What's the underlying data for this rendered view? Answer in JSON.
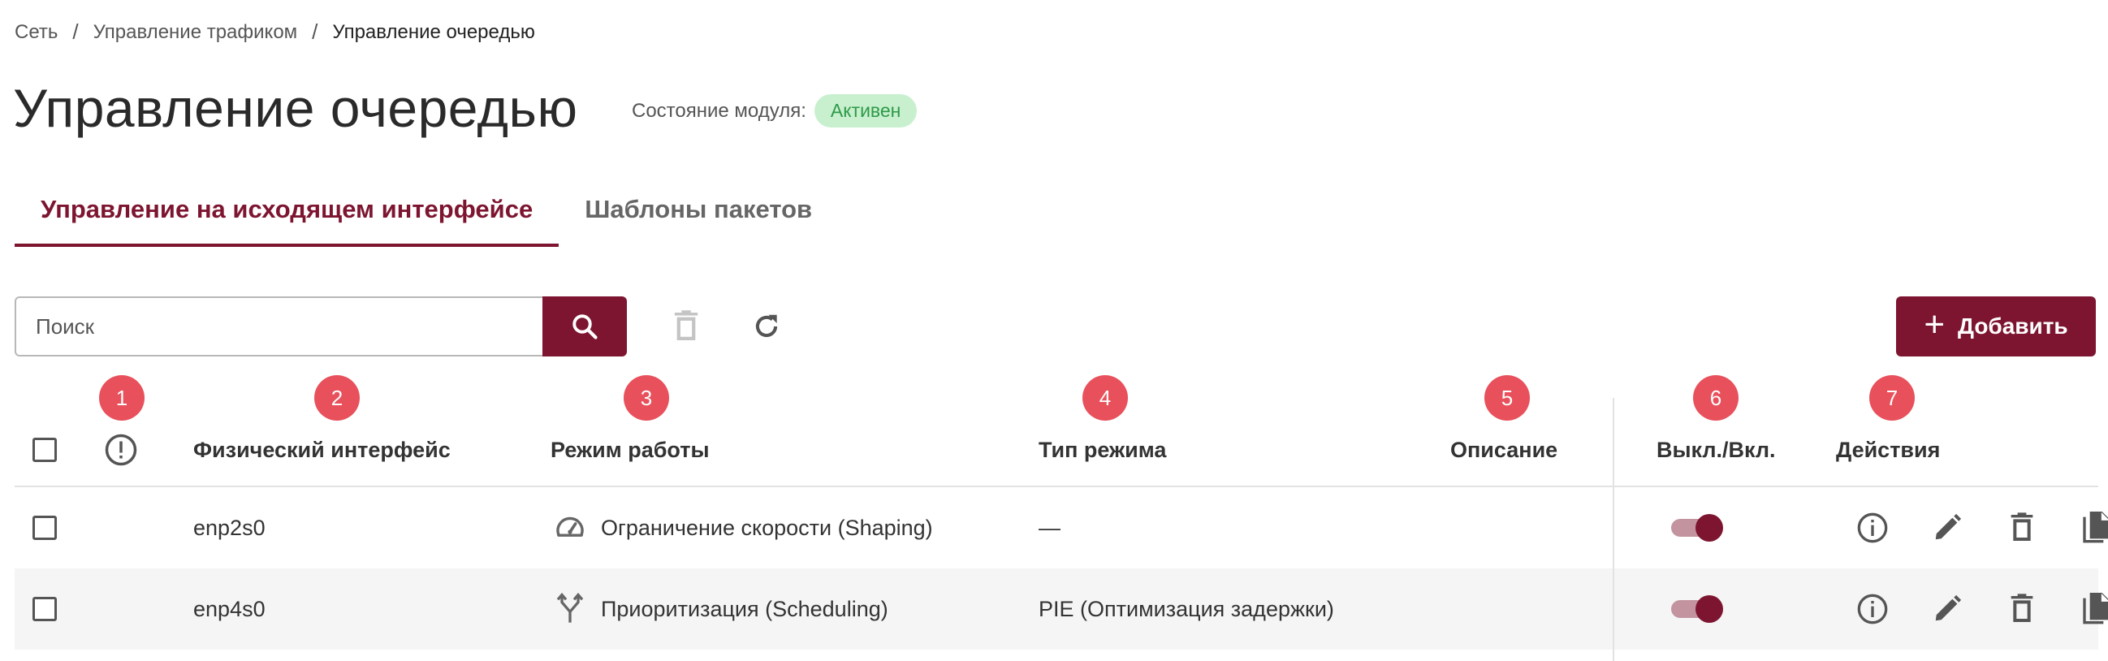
{
  "breadcrumb": {
    "items": [
      "Сеть",
      "Управление трафиком",
      "Управление очередью"
    ],
    "separator": "/"
  },
  "header": {
    "title": "Управление очередью",
    "module_state_label": "Состояние модуля:",
    "module_state_value": "Активен"
  },
  "tabs": [
    {
      "label": "Управление на исходящем интерфейсе",
      "active": true
    },
    {
      "label": "Шаблоны пакетов",
      "active": false
    }
  ],
  "toolbar": {
    "search_placeholder": "Поиск",
    "add_label": "Добавить"
  },
  "markers": [
    "1",
    "2",
    "3",
    "4",
    "5",
    "6",
    "7"
  ],
  "table": {
    "columns": {
      "interface": "Физический интерфейс",
      "mode": "Режим работы",
      "mode_type": "Тип режима",
      "description": "Описание",
      "toggle": "Выкл./Вкл.",
      "actions": "Действия"
    },
    "rows": [
      {
        "interface": "enp2s0",
        "mode_icon": "gauge-icon",
        "mode": "Ограничение скорости (Shaping)",
        "mode_type": "—",
        "description": "",
        "enabled": true
      },
      {
        "interface": "enp4s0",
        "mode_icon": "merge-arrows-icon",
        "mode": "Приоритизация (Scheduling)",
        "mode_type": "PIE (Оптимизация задержки)",
        "description": "",
        "enabled": true
      }
    ]
  },
  "colors": {
    "accent": "#7d1530",
    "badge_bg": "#c8f0cf",
    "badge_text": "#2e9a47",
    "marker": "#e8505b",
    "toggle_track": "#c3949f"
  }
}
